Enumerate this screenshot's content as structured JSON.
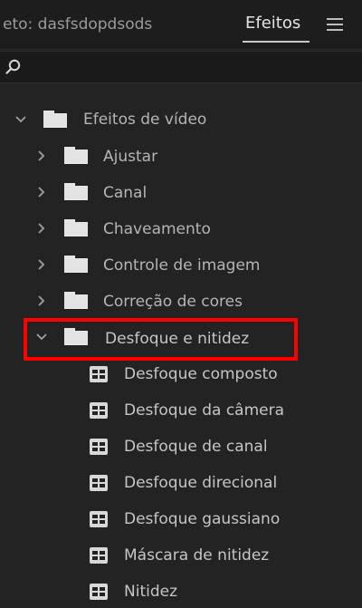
{
  "header": {
    "project_tab": "eto: dasfsdopdsods",
    "effects_tab": "Efeitos"
  },
  "search": {
    "value": ""
  },
  "tree": {
    "root": "Efeitos de vídeo",
    "categories": [
      "Ajustar",
      "Canal",
      "Chaveamento",
      "Controle de imagem",
      "Correção de cores",
      "Desfoque e nitidez"
    ],
    "effects": [
      "Desfoque composto",
      "Desfoque da câmera",
      "Desfoque de canal",
      "Desfoque direcional",
      "Desfoque gaussiano",
      "Máscara de nitidez",
      "Nitidez"
    ]
  },
  "colors": {
    "background": "#232323",
    "highlight": "#ff0000"
  }
}
